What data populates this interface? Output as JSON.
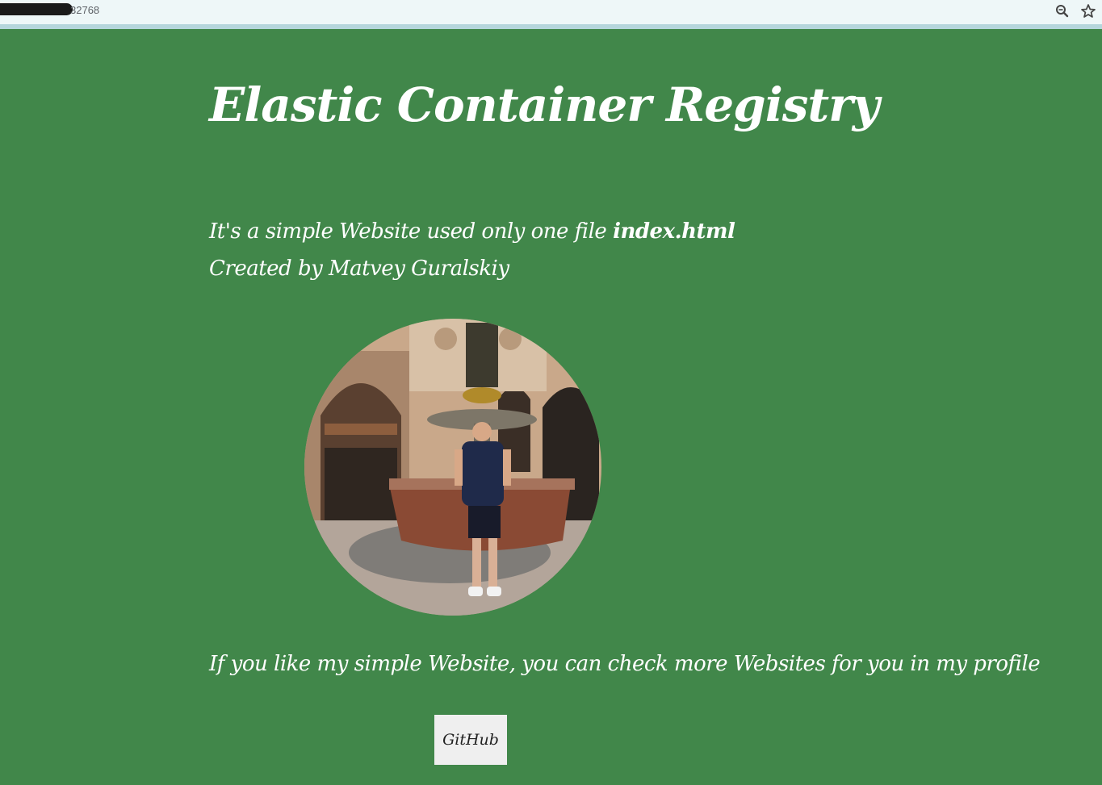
{
  "browser": {
    "url_visible": "32768",
    "icons": [
      "zoom-icon",
      "star-icon"
    ]
  },
  "page": {
    "title": "Elastic Container Registry",
    "intro_text": "It's a simple Website used only one file ",
    "intro_file": "index.html",
    "author_line": "Created by Matvey Guralskiy",
    "photo_alt": "",
    "profile_text": "If you like my simple Website, you can check more Websites for you in my profile",
    "github_label": "GitHub"
  },
  "colors": {
    "background": "#41874a",
    "text": "#ffffff",
    "button_bg": "#efefef"
  }
}
